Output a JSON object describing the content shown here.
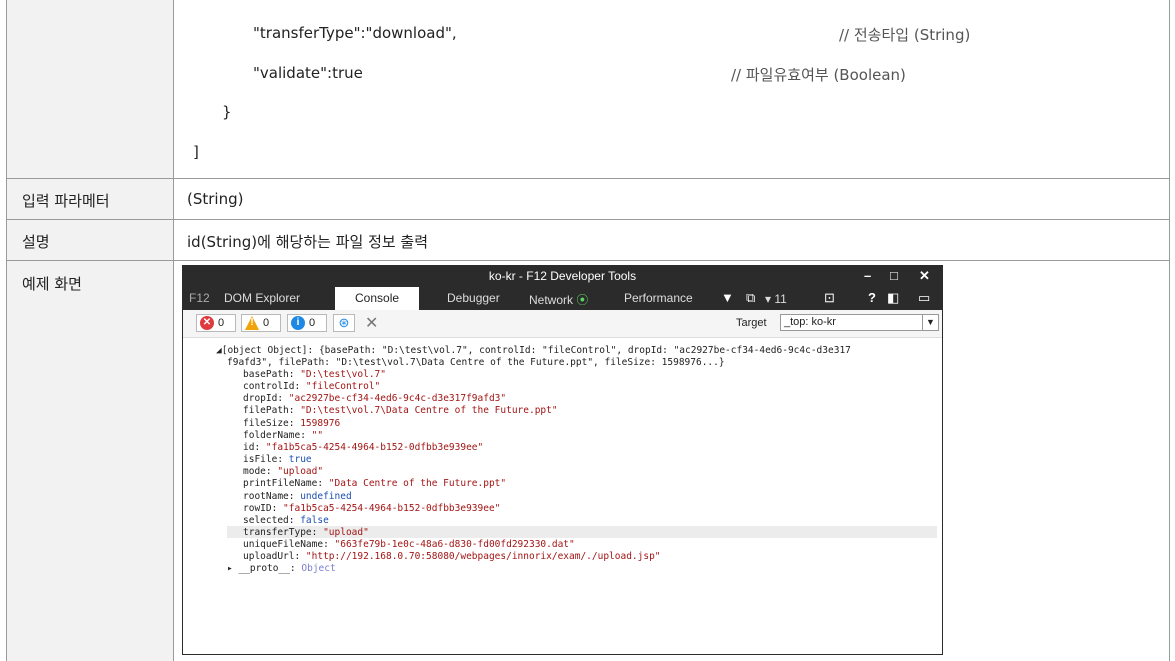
{
  "code": {
    "line1": "\"transferType\":\"download\",",
    "comment1": "// 전송타입 (String)",
    "line2": "\"validate\":true",
    "comment2": "// 파일유효여부 (Boolean)",
    "brace_close": "}",
    "bracket_close": "]"
  },
  "rows": {
    "input": {
      "label": "입력 파라메터",
      "value": "(String)"
    },
    "desc": {
      "label": "설명",
      "value": "id(String)에 해당하는 파일 정보 출력"
    },
    "example": {
      "label": "예제 화면"
    }
  },
  "devtools": {
    "title": "ko-kr - F12 Developer Tools",
    "window_controls": [
      "–",
      "□",
      "✕"
    ],
    "tabs": [
      "F12",
      "DOM Explorer",
      "Console",
      "Debugger",
      "Network",
      "Performance"
    ],
    "active_tab": "Console",
    "emulation_count": "11",
    "counters": {
      "errors": "0",
      "warnings": "0",
      "info": "0"
    },
    "target_label": "Target",
    "target_value": "_top: ko-kr",
    "console": {
      "summary_1": "[object Object]: {basePath: \"D:\\test\\vol.7\", controlId: \"fileControl\", dropId: \"ac2927be-cf34-4ed6-9c4c-d3e317",
      "summary_2": "f9afd3\", filePath: \"D:\\test\\vol.7\\Data Centre of the Future.ppt\", fileSize: 1598976...}",
      "props": [
        {
          "key": "basePath: ",
          "value": "\"D:\\test\\vol.7\"",
          "kind": "str"
        },
        {
          "key": "controlId: ",
          "value": "\"fileControl\"",
          "kind": "str"
        },
        {
          "key": "dropId: ",
          "value": "\"ac2927be-cf34-4ed6-9c4c-d3e317f9afd3\"",
          "kind": "str"
        },
        {
          "key": "filePath: ",
          "value": "\"D:\\test\\vol.7\\Data Centre of the Future.ppt\"",
          "kind": "str"
        },
        {
          "key": "fileSize: ",
          "value": "1598976",
          "kind": "str"
        },
        {
          "key": "folderName: ",
          "value": "\"\"",
          "kind": "str"
        },
        {
          "key": "id: ",
          "value": "\"fa1b5ca5-4254-4964-b152-0dfbb3e939ee\"",
          "kind": "str"
        },
        {
          "key": "isFile: ",
          "value": "true",
          "kind": "kw"
        },
        {
          "key": "mode: ",
          "value": "\"upload\"",
          "kind": "str"
        },
        {
          "key": "printFileName: ",
          "value": "\"Data Centre of the Future.ppt\"",
          "kind": "str"
        },
        {
          "key": "rootName: ",
          "value": "undefined",
          "kind": "kw"
        },
        {
          "key": "rowID: ",
          "value": "\"fa1b5ca5-4254-4964-b152-0dfbb3e939ee\"",
          "kind": "str"
        },
        {
          "key": "selected: ",
          "value": "false",
          "kind": "kw"
        },
        {
          "key": "transferType: ",
          "value": "\"upload\"",
          "kind": "str"
        },
        {
          "key": "uniqueFileName: ",
          "value": "\"663fe79b-1e0c-48a6-d830-fd00fd292330.dat\"",
          "kind": "str"
        },
        {
          "key": "uploadUrl: ",
          "value": "\"http://192.168.0.70:58080/webpages/innorix/exam/./upload.jsp\"",
          "kind": "str"
        }
      ],
      "proto_key": "__proto__: ",
      "proto_value": "Object"
    }
  }
}
